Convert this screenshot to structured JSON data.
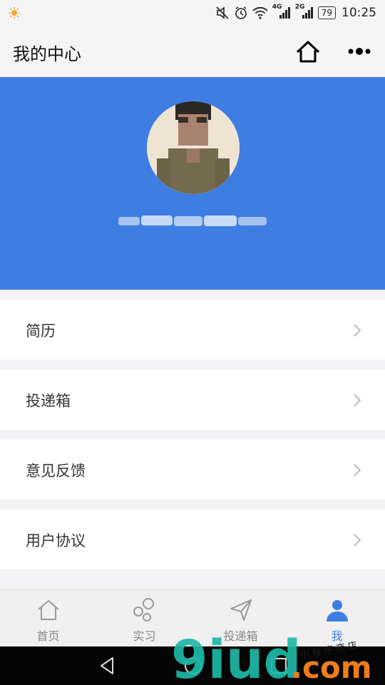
{
  "status_bar": {
    "network_4g": "4G",
    "network_2g": "2G",
    "battery": "79",
    "time": "10:25"
  },
  "header": {
    "title": "我的中心"
  },
  "menu": {
    "items": [
      {
        "label": "简历"
      },
      {
        "label": "投递箱"
      },
      {
        "label": "意见反馈"
      },
      {
        "label": "用户协议"
      }
    ]
  },
  "tab_bar": {
    "tabs": [
      {
        "label": "首页",
        "active": false
      },
      {
        "label": "实习",
        "active": false
      },
      {
        "label": "投递箱",
        "active": false
      },
      {
        "label": "我",
        "active": true
      }
    ]
  },
  "watermark": {
    "brand": "9iud",
    "suffix": ".com",
    "tagline": "小程序商店"
  },
  "colors": {
    "accent": "#3e7ee2",
    "background": "#f3f3f5",
    "watermark_teal": "#1fb8a8",
    "watermark_orange": "#f07d1a"
  }
}
